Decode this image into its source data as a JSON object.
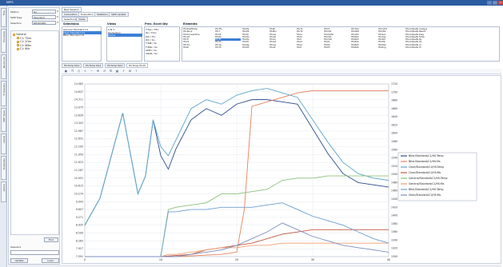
{
  "window": {
    "title": "MIPS"
  },
  "left_panel": {
    "fields": [
      {
        "label": "Station",
        "value": "Gy",
        "dropdown": true
      },
      {
        "label": "SWP Type",
        "value": "Standard",
        "dropdown": true
      },
      {
        "label": "Selection",
        "value": "RELEASED",
        "dropdown": true
      }
    ],
    "tree": [
      {
        "label": "General",
        "indent": 0
      },
      {
        "label": "C1: T2ler",
        "indent": 1
      },
      {
        "label": "C1: 2Oer",
        "indent": 1
      },
      {
        "label": "C1: 6Ner",
        "indent": 1
      },
      {
        "label": "C1: 8Nr",
        "indent": 1
      }
    ],
    "find_button": "Find",
    "sessions_label": "Sessions",
    "update_button": "Update",
    "load_button": "Load"
  },
  "vertical_tabs": [
    "Files",
    "Processes",
    "Resources",
    "Schedulers",
    "SWP Types",
    "Labels",
    "Templates",
    "Addins"
  ],
  "top_tabs": [
    "New Session"
  ],
  "sub_tabs": [
    "Calculation",
    "Evaluation",
    "Statistics",
    "SWP Update"
  ],
  "selection": {
    "tabs": [
      "Selections",
      "Views"
    ],
    "selections_header": "Selections",
    "selections": [
      "General Standard C1",
      "Clear Standard C1",
      "Btler Standard C1"
    ],
    "views_header": "Views",
    "views": [
      "C.N.T",
      "Production",
      "Errors"
    ],
    "prec_header": "Prec. Excel Qty",
    "prec": [
      "T'Tan / Tfhr",
      "Ze / Tfun",
      "Dill / Thr",
      "Dill / Sn",
      "T'INE / Sn",
      "T'ING / Sn",
      "SPEC / Sn",
      "CNCR / Sn"
    ],
    "elements_header": "Elements",
    "elements": [
      [
        "HS:ShelfTemp",
        "HS:Temp",
        "HS:ProcessTime",
        "HS:Alt",
        "HS:Tc",
        "HS:Hl",
        "HS:Tm",
        "HS:Rl"
      ],
      [
        "HS:Tfh",
        "HS:T",
        "HS:Dt",
        "HS:Rh",
        "HS:Ta",
        "HS:Tb",
        "HS:Tg",
        "HS:Th"
      ],
      [
        "HS:Ma",
        "HS:Mb",
        "HS:Mc",
        "HS:Md",
        "HS:Me",
        "HS:Mf",
        "HS:Mg",
        "HS:Mh"
      ],
      [
        "HS:Bl",
        "HS:Bm",
        "HS:Ga",
        "HS:Gb",
        "HS:Gc",
        "HS:Gd",
        "HS:Ge",
        "HS:Gf"
      ],
      [
        "HS:Tz",
        "HS:Tk",
        "HS:Ia",
        "HS:Ib",
        "HS:Ic",
        "HS:Id",
        "HS:Ie",
        "HS:If"
      ],
      [
        "HS:Fh",
        "HS:Hs2",
        "HS:HsOD",
        "HS:Hs3",
        "HS:HsD",
        "HS:P1",
        "HS:P2",
        "HS:P3"
      ],
      [
        "HS:TO2",
        "HS:N2O",
        "HS:CEX",
        "HS:Rb2",
        "HS:Rb3",
        "HS:Rb4",
        "HS:Rb5",
        "HS:Rb6"
      ],
      [
        "HS:CaT2",
        "HS:Hist",
        "HS:Set",
        "HS:Avg",
        "HS:Std",
        "HS:Min",
        "HS:Max",
        "HS:Rng"
      ],
      [
        "HS:UnShelfe Analyse",
        "HS:UnShelfe Result",
        "HS:UnShelfe Diag",
        "HS:UnShelfe Temp",
        "HS:UnShelfe Kp",
        "HS:UnShelfe Ok",
        "HS:UnShelfe Lo",
        "HS:UnShelfe Hi"
      ]
    ]
  },
  "chart_tabs": [
    "HS:Temp 8/12",
    "HS:Temp 8/12",
    "HS:Temp 8/12",
    "HS:Temp HS:Pt"
  ],
  "toolbar_icons": [
    "save-icon",
    "copy-icon",
    "print-icon",
    "zoom-in-icon",
    "zoom-out-icon",
    "pan-icon",
    "reset-icon",
    "legend-icon",
    "grid-icon",
    "export-icon",
    "settings-icon",
    "help-icon"
  ],
  "chart_data": {
    "type": "line",
    "title": "",
    "xlabel": "",
    "ylabel": "",
    "x_ticks": [
      0,
      10,
      20,
      30,
      40
    ],
    "xlim": [
      0,
      40
    ],
    "y_ticks_left": [
      "7.591",
      "7.927",
      "8.263",
      "8.599",
      "8.935",
      "9.271",
      "9.607",
      "9.943",
      "10.279",
      "10.615",
      "10.951",
      "11.287",
      "11.623",
      "11.959",
      "12.295",
      "12.631",
      "12.967",
      "13.303",
      "13.639",
      "13.975",
      "14.311",
      "14.647",
      "14.983"
    ],
    "y_ticks_right": [
      "1720",
      "1700",
      "1680",
      "1660",
      "1640",
      "1620",
      "1600",
      "1580",
      "1560",
      "1540",
      "1520",
      "1500",
      "1480",
      "1460",
      "1440",
      "1420",
      "1400",
      "1380",
      "1360",
      "1340",
      "1320",
      "1300"
    ],
    "ylim": [
      7.5,
      15.2
    ],
    "legend": "right",
    "grid": true,
    "series": [
      {
        "name": "Btler/Standard/C1/HS:Temp",
        "color": "#2d4d8c",
        "x": [
          0,
          2,
          5,
          7,
          8,
          9,
          10,
          11,
          12,
          14,
          16,
          18,
          20,
          22,
          24,
          26,
          28,
          30,
          32,
          34,
          36,
          38,
          40
        ],
        "values": [
          8.9,
          10.1,
          13.9,
          10.3,
          11.1,
          13.6,
          12.0,
          11.4,
          12.3,
          13.6,
          14.1,
          13.8,
          14.3,
          14.5,
          14.5,
          14.4,
          14.3,
          13.2,
          12.1,
          11.2,
          10.8,
          10.7,
          10.6
        ]
      },
      {
        "name": "Btler/Standard/C1/HS:Ms",
        "color": "#e8805f",
        "x": [
          0,
          12,
          18,
          20,
          21,
          22,
          24,
          26,
          28,
          30,
          32,
          34,
          36,
          38,
          40
        ],
        "values": [
          7.5,
          7.5,
          7.6,
          7.7,
          9.6,
          14.2,
          14.4,
          14.6,
          14.8,
          14.9,
          14.9,
          14.9,
          14.9,
          14.9,
          14.9
        ]
      },
      {
        "name": "Clear/Standard/C1/HS:Temp",
        "color": "#5ea7c9",
        "x": [
          0,
          2,
          5,
          7,
          8,
          9,
          10,
          11,
          12,
          14,
          16,
          18,
          20,
          22,
          24,
          26,
          28,
          30,
          32,
          34,
          36,
          38,
          40
        ],
        "values": [
          8.9,
          10.1,
          13.9,
          10.3,
          11.1,
          13.6,
          12.4,
          12.0,
          12.7,
          14.1,
          14.5,
          14.3,
          14.7,
          14.9,
          15.0,
          14.8,
          14.6,
          13.6,
          12.6,
          11.7,
          11.2,
          11.0,
          10.9
        ]
      },
      {
        "name": "Clear/Standard/C1/HS:Ms",
        "color": "#c4573f",
        "x": [
          0,
          10,
          14,
          16,
          18,
          20,
          22,
          24,
          26,
          28,
          30,
          32,
          34,
          36,
          38,
          40
        ],
        "values": [
          7.5,
          7.5,
          7.6,
          7.8,
          7.9,
          8.0,
          8.1,
          8.3,
          8.5,
          8.6,
          8.7,
          8.7,
          8.7,
          8.7,
          8.7,
          8.7
        ]
      },
      {
        "name": "General/Standard/C1/HS:Temp",
        "color": "#8cc17a",
        "x": [
          0,
          10,
          11,
          12,
          14,
          16,
          18,
          20,
          22,
          24,
          26,
          28,
          30,
          32,
          34,
          36,
          38,
          40
        ],
        "values": [
          7.5,
          7.5,
          9.6,
          9.7,
          9.8,
          9.9,
          10.3,
          10.3,
          10.4,
          10.5,
          10.9,
          11.0,
          11.0,
          11.1,
          11.1,
          11.1,
          11.1,
          11.1
        ]
      },
      {
        "name": "General/Standard/C1/HS:Ms",
        "color": "#f0a070",
        "x": [
          0,
          10,
          11,
          12,
          14,
          16,
          18,
          20,
          22,
          24,
          26,
          28,
          30,
          32,
          34,
          36,
          38,
          40
        ],
        "values": [
          7.5,
          7.5,
          7.6,
          7.6,
          7.7,
          7.8,
          7.9,
          7.9,
          8.0,
          8.0,
          8.1,
          8.1,
          8.1,
          8.1,
          8.1,
          8.1,
          8.1,
          8.1
        ]
      },
      {
        "name": "Btler/Standard/C1/HS:Temp",
        "color": "#6d9fd0",
        "x": [
          0,
          10,
          11,
          12,
          14,
          16,
          18,
          20,
          22,
          24,
          26,
          28,
          30,
          32,
          34,
          36,
          38,
          40
        ],
        "values": [
          7.5,
          7.5,
          9.5,
          9.5,
          9.6,
          9.6,
          9.7,
          9.7,
          9.7,
          9.8,
          9.9,
          9.6,
          9.3,
          9.1,
          8.9,
          8.6,
          8.3,
          8.1
        ]
      },
      {
        "name": "Gllen/Standard/C1/HS:Ms",
        "color": "#7b8fbe",
        "x": [
          0,
          10,
          12,
          14,
          16,
          18,
          20,
          22,
          24,
          26,
          28,
          30,
          32,
          34,
          36,
          38,
          40
        ],
        "values": [
          7.5,
          7.5,
          7.5,
          7.6,
          7.7,
          7.8,
          8.0,
          8.3,
          8.6,
          9.0,
          8.7,
          8.4,
          8.2,
          8.0,
          7.9,
          7.8,
          7.7
        ]
      }
    ]
  },
  "statusbar": {
    "text": ""
  }
}
